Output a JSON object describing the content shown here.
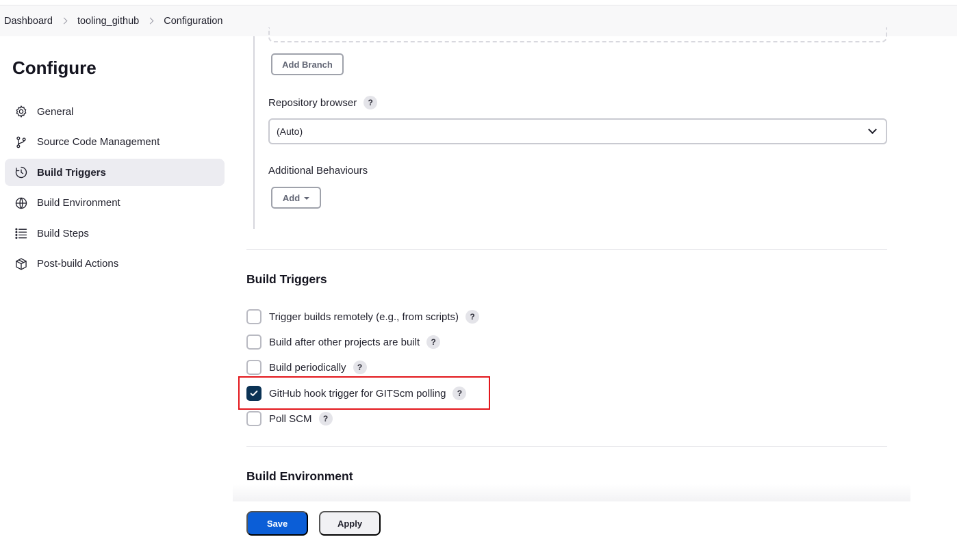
{
  "breadcrumb": {
    "items": [
      "Dashboard",
      "tooling_github",
      "Configuration"
    ]
  },
  "sidebar": {
    "title": "Configure",
    "items": [
      {
        "label": "General",
        "icon": "gear-icon",
        "active": false
      },
      {
        "label": "Source Code Management",
        "icon": "branch-icon",
        "active": false
      },
      {
        "label": "Build Triggers",
        "icon": "clock-icon",
        "active": true
      },
      {
        "label": "Build Environment",
        "icon": "globe-icon",
        "active": false
      },
      {
        "label": "Build Steps",
        "icon": "list-icon",
        "active": false
      },
      {
        "label": "Post-build Actions",
        "icon": "package-icon",
        "active": false
      }
    ]
  },
  "scm": {
    "add_branch_label": "Add Branch",
    "repo_browser_label": "Repository browser",
    "repo_browser_value": "(Auto)",
    "additional_behaviours_label": "Additional Behaviours",
    "add_label": "Add"
  },
  "help_glyph": "?",
  "build_triggers": {
    "title": "Build Triggers",
    "options": [
      {
        "label": "Trigger builds remotely (e.g., from scripts)",
        "checked": false
      },
      {
        "label": "Build after other projects are built",
        "checked": false
      },
      {
        "label": "Build periodically",
        "checked": false
      },
      {
        "label": "GitHub hook trigger for GITScm polling",
        "checked": true
      },
      {
        "label": "Poll SCM",
        "checked": false
      }
    ]
  },
  "build_environment": {
    "title": "Build Environment"
  },
  "actions": {
    "save_label": "Save",
    "apply_label": "Apply"
  },
  "colors": {
    "primary": "#0b5ed7",
    "checkbox_checked": "#0b3355",
    "highlight": "#e3161b"
  }
}
